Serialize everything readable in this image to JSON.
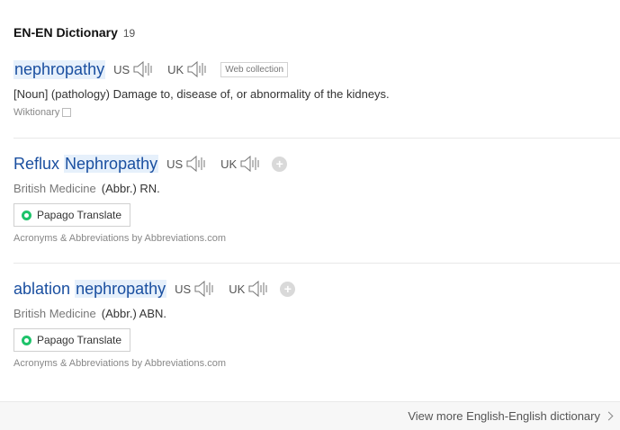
{
  "header": {
    "title": "EN-EN Dictionary",
    "count": "19"
  },
  "entries": [
    {
      "headword": "nephropathy",
      "us": "US",
      "uk": "UK",
      "web_collection": "Web collection",
      "definition": "[Noun] (pathology) Damage to, disease of, or abnormality of the kidneys.",
      "source": "Wiktionary"
    },
    {
      "headword_pre": "Reflux ",
      "headword_hl": "Nephropathy",
      "us": "US",
      "uk": "UK",
      "field": "British Medicine",
      "abbr": "(Abbr.) RN.",
      "papago": "Papago Translate",
      "source": "Acronyms & Abbreviations by Abbreviations.com"
    },
    {
      "headword_pre": "ablation ",
      "headword_hl": "nephropathy",
      "us": "US",
      "uk": "UK",
      "field": "British Medicine",
      "abbr": "(Abbr.) ABN.",
      "papago": "Papago Translate",
      "source": "Acronyms & Abbreviations by Abbreviations.com"
    }
  ],
  "footer": {
    "more": "View more English-English dictionary"
  },
  "colors": {
    "link": "#1a4fa0",
    "highlight": "#e6f0fb",
    "papago": "#1ec36a"
  }
}
